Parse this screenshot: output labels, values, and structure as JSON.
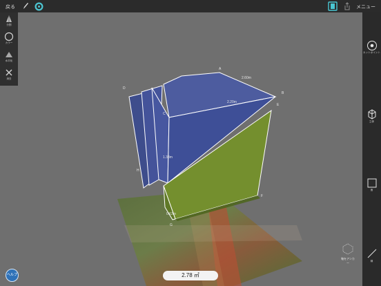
{
  "toolbar": {
    "back_label": "戻る",
    "menu_label": "メニュー",
    "pencil_icon": "pencil-icon",
    "gear_icon": "gear-icon",
    "film_icon": "film-icon",
    "share_icon": "share-icon"
  },
  "left_tools": [
    {
      "label": "分割"
    },
    {
      "label": "カラー"
    },
    {
      "label": "水平化"
    },
    {
      "label": "消去"
    }
  ],
  "right_tools": [
    {
      "label": "カットポイント"
    },
    {
      "label": "立体"
    },
    {
      "label": "面"
    },
    {
      "label": "線"
    }
  ],
  "scene": {
    "vertex_labels": [
      "A",
      "B",
      "C",
      "D",
      "E",
      "F",
      "G",
      "H"
    ],
    "measurements": [
      "2.60m",
      "2.20m",
      "1.33m",
      "0.63m"
    ]
  },
  "volume_display": "2.78 ㎥",
  "help_button": "ヘルプ",
  "axis_label": "軸をアンカー"
}
